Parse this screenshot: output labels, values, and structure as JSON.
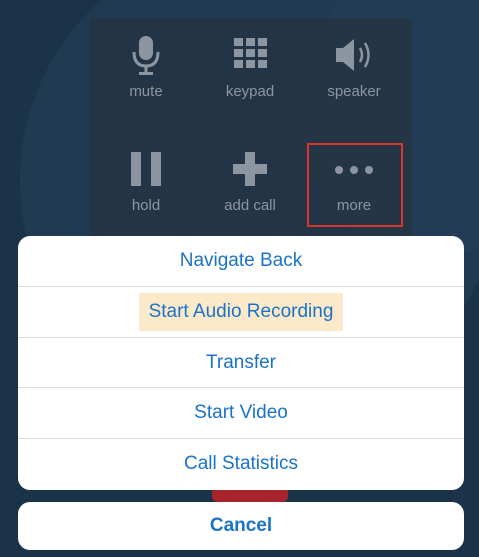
{
  "controls": {
    "mute_label": "mute",
    "keypad_label": "keypad",
    "speaker_label": "speaker",
    "hold_label": "hold",
    "add_call_label": "add call",
    "more_label": "more"
  },
  "action_sheet": {
    "items": [
      {
        "label": "Navigate Back"
      },
      {
        "label": "Start Audio Recording"
      },
      {
        "label": "Transfer"
      },
      {
        "label": "Start Video"
      },
      {
        "label": "Call Statistics"
      }
    ],
    "cancel_label": "Cancel"
  },
  "colors": {
    "background": "#1b3349",
    "action_text": "#1a73c8",
    "highlight": "#fbe9c9",
    "more_outline": "#d9352f",
    "end_call": "#a8232b"
  }
}
